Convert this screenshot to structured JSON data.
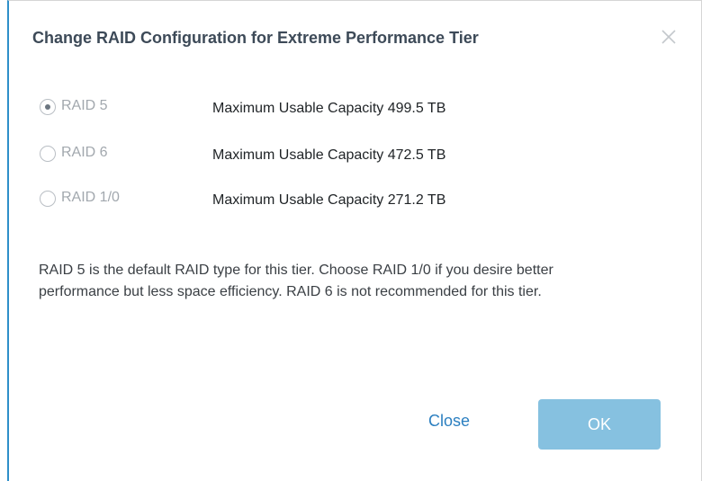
{
  "dialog": {
    "title": "Change RAID Configuration for Extreme Performance Tier",
    "close_icon": "close-icon",
    "options": [
      {
        "label": "RAID 5",
        "capacity": "Maximum Usable Capacity 499.5 TB",
        "selected": true
      },
      {
        "label": "RAID 6",
        "capacity": "Maximum Usable Capacity 472.5 TB",
        "selected": false
      },
      {
        "label": "RAID 1/0",
        "capacity": "Maximum Usable Capacity 271.2 TB",
        "selected": false
      }
    ],
    "description": "RAID 5 is the default RAID type for this tier. Choose RAID 1/0 if you desire better performance but less space efficiency. RAID 6 is not recommended for this tier.",
    "close_label": "Close",
    "ok_label": "OK"
  },
  "colors": {
    "accent_border": "#2f8fc9",
    "link": "#2b7fc0",
    "ok_button_disabled": "#86c1e0",
    "muted_label": "#a2a8ae"
  }
}
